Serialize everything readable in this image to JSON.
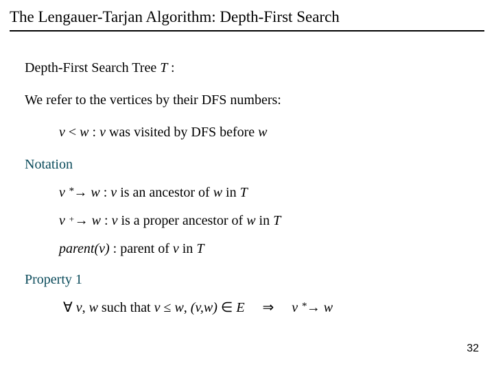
{
  "title": "The Lengauer-Tarjan Algorithm: Depth-First Search",
  "line1_a": "Depth-First Search Tree  ",
  "line1_T": "T ",
  "line1_b": ":",
  "line2": "We refer to the vertices by their DFS numbers:",
  "defn_v": "v ",
  "defn_lt": "< ",
  "defn_w": "w ",
  "defn_colon": ":  ",
  "defn_v2": "v  ",
  "defn_rest": " was visited by DFS before  ",
  "defn_w2": "w",
  "notation_label": "Notation",
  "n1_v": "v ",
  "n1_star": "*",
  "n1_arrow": "→ ",
  "n1_w": "w ",
  "n1_txt1": ":  ",
  "n1_v2": "v ",
  "n1_mid": " is an ancestor of  ",
  "n1_w2": "w ",
  "n1_in": " in  ",
  "n1_T": "T",
  "n2_v": "v ",
  "n2_plus": "+",
  "n2_arrow": "→ ",
  "n2_w": "w ",
  "n2_txt1": ":  ",
  "n2_v2": "v ",
  "n2_mid": " is a proper ancestor of  ",
  "n2_w2": "w ",
  "n2_in": " in  ",
  "n2_T": "T",
  "n3_parent": "parent(v) ",
  "n3_txt": ":  parent of  ",
  "n3_v": "v ",
  "n3_in": " in  ",
  "n3_T": "T",
  "prop_label": "Property 1",
  "p_forall": "∀ ",
  "p_v": "v",
  "p_comma": ", ",
  "p_w": "w ",
  "p_such": " such that  ",
  "p_v2": "v ",
  "p_le": "≤ ",
  "p_w2": "w",
  "p_comma2": ",   ",
  "p_open": "(",
  "p_v3": "v",
  "p_comma3": ",",
  "p_w3": "w",
  "p_close": ") ",
  "p_in": "∈ ",
  "p_E": "E",
  "p_imp": "⇒",
  "p_v4": "v ",
  "p_star": "*",
  "p_arrow": "→ ",
  "p_w4": "w",
  "pagenum": "32"
}
